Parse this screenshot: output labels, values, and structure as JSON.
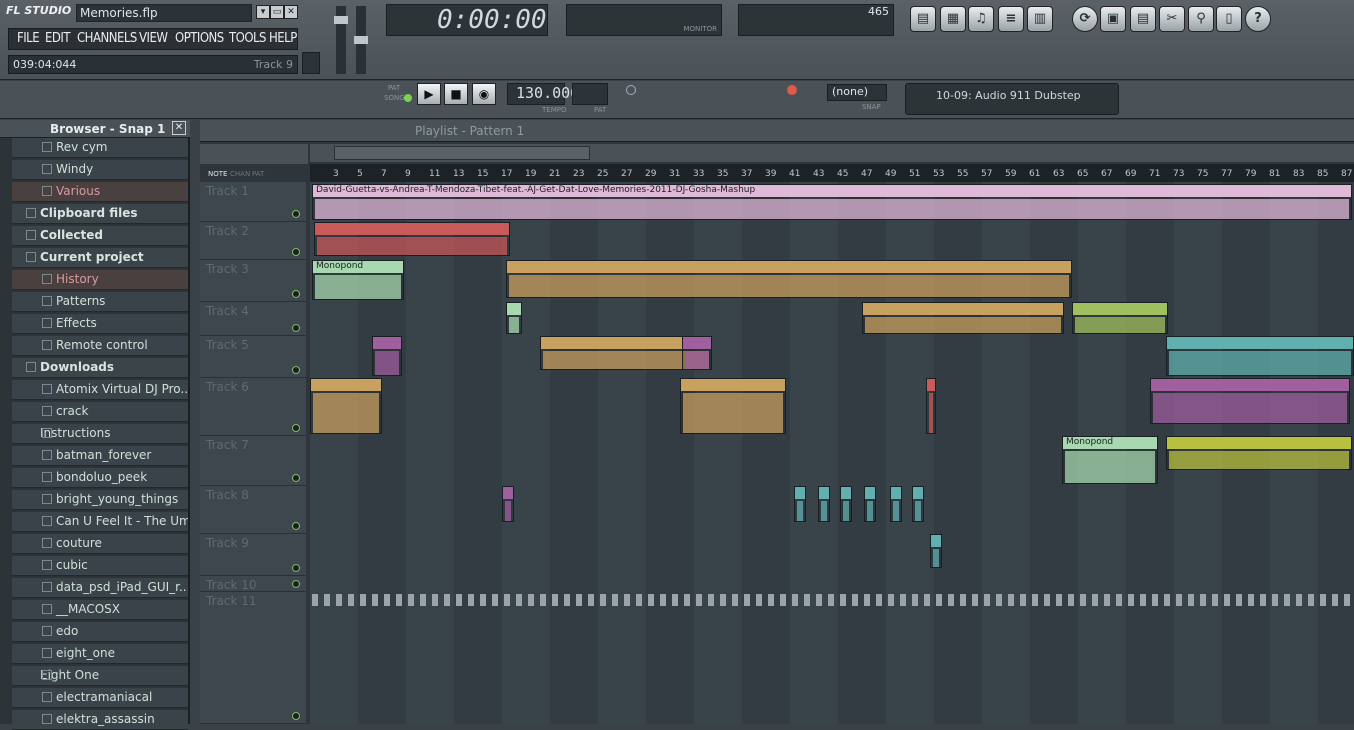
{
  "app": {
    "logo": "FL STUDIO",
    "file": "Memories.flp"
  },
  "menu": [
    "FILE",
    "EDIT",
    "CHANNELS",
    "VIEW",
    "OPTIONS",
    "TOOLS",
    "HELP"
  ],
  "hint": {
    "position": "039:04:044",
    "track": "Track 9"
  },
  "time": "0:00:00",
  "cpu": {
    "value": "465"
  },
  "monitor_label": "MONITOR",
  "transport": {
    "pat_label": "PAT",
    "song_label": "SONG",
    "tempo": "130.000",
    "tempo_label": "TEMPO",
    "pat_num_label": "PAT"
  },
  "snap": {
    "value": "(none)",
    "label": "SNAP"
  },
  "news": "10-09: Audio 911 Dubstep",
  "browser": {
    "title": "Browser - Snap 1",
    "items": [
      {
        "label": "Rev cym",
        "kind": "sub"
      },
      {
        "label": "Windy",
        "kind": "sub"
      },
      {
        "label": "Various",
        "kind": "hl"
      },
      {
        "label": "Clipboard files",
        "kind": "folder"
      },
      {
        "label": "Collected",
        "kind": "folder"
      },
      {
        "label": "Current project",
        "kind": "folder"
      },
      {
        "label": "History",
        "kind": "hl"
      },
      {
        "label": "Patterns",
        "kind": "sub"
      },
      {
        "label": "Effects",
        "kind": "sub"
      },
      {
        "label": "Remote control",
        "kind": "sub"
      },
      {
        "label": "Downloads",
        "kind": "folder"
      },
      {
        "label": "Atomix Virtual DJ Pro...",
        "kind": "sub"
      },
      {
        "label": "crack",
        "kind": "sub"
      },
      {
        "label": "Instructions",
        "kind": "plain"
      },
      {
        "label": "batman_forever",
        "kind": "sub"
      },
      {
        "label": "bondoluo_peek",
        "kind": "sub"
      },
      {
        "label": "bright_young_things",
        "kind": "sub"
      },
      {
        "label": "Can U Feel It - The Um...",
        "kind": "sub"
      },
      {
        "label": "couture",
        "kind": "sub"
      },
      {
        "label": "cubic",
        "kind": "sub"
      },
      {
        "label": "data_psd_iPad_GUI_r...",
        "kind": "sub"
      },
      {
        "label": "__MACOSX",
        "kind": "sub"
      },
      {
        "label": "edo",
        "kind": "sub"
      },
      {
        "label": "eight_one",
        "kind": "sub"
      },
      {
        "label": "Eight One",
        "kind": "plain"
      },
      {
        "label": "electramaniacal",
        "kind": "sub"
      },
      {
        "label": "elektra_assassin",
        "kind": "sub"
      }
    ]
  },
  "playlist": {
    "title": "Playlist - Pattern 1",
    "tabs": [
      "NOTE",
      "CHAN",
      "PAT"
    ],
    "ruler": [
      "3",
      "5",
      "7",
      "9",
      "11",
      "13",
      "15",
      "17",
      "19",
      "21",
      "23",
      "25",
      "27",
      "29",
      "31",
      "33",
      "35",
      "37",
      "39",
      "41",
      "43",
      "45",
      "47",
      "49",
      "51",
      "53",
      "55",
      "57",
      "59",
      "61",
      "63",
      "65",
      "67",
      "69",
      "71",
      "73",
      "75",
      "77",
      "79",
      "81",
      "83",
      "85",
      "87"
    ],
    "tracks": [
      "Track 1",
      "Track 2",
      "Track 3",
      "Track 4",
      "Track 5",
      "Track 6",
      "Track 7",
      "Track 8",
      "Track 9",
      "Track 10",
      "Track 11"
    ],
    "clip_names": {
      "audio": "David-Guetta-vs-Andrea-T-Mendoza-Tibet-feat.-AJ-Get-Dat-Love-Memories-2011-DJ-Gosha-Mashup",
      "mono1": "Monopond",
      "mono2": "Monopond"
    }
  },
  "colors": {
    "red": "#c85a5a",
    "orange": "#c8a060",
    "purple": "#a060a0",
    "teal": "#60b0b0",
    "green": "#a0c060",
    "lime": "#b8c040",
    "pink": "#e0b8d8",
    "mint": "#a8d8b0"
  }
}
